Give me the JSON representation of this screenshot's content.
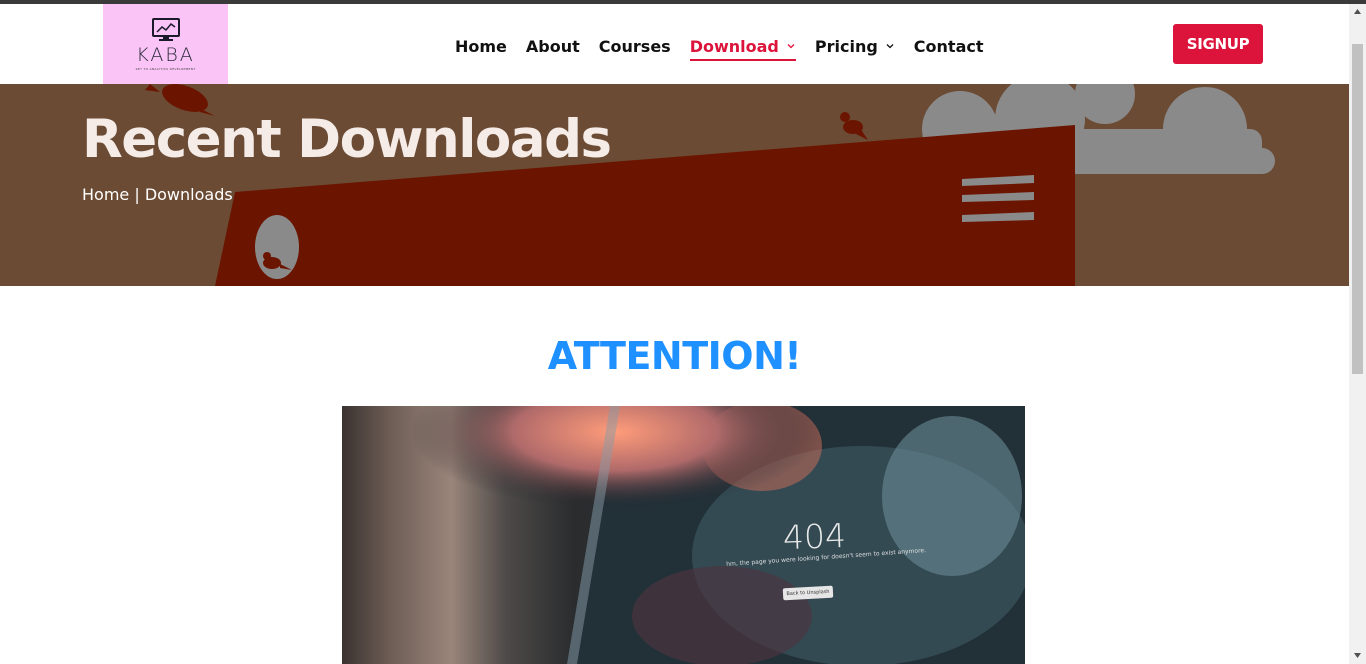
{
  "brand": {
    "name": "KABA",
    "tagline": "KEY TO ANALYTICS DEVELOPMENT",
    "logo_bg": "#fbc4f6"
  },
  "nav": {
    "items": [
      {
        "label": "Home",
        "active": false,
        "dropdown": false
      },
      {
        "label": "About",
        "active": false,
        "dropdown": false
      },
      {
        "label": "Courses",
        "active": false,
        "dropdown": false
      },
      {
        "label": "Download",
        "active": true,
        "dropdown": true
      },
      {
        "label": "Pricing",
        "active": false,
        "dropdown": true
      },
      {
        "label": "Contact",
        "active": false,
        "dropdown": false
      }
    ],
    "signup_label": "SIGNUP"
  },
  "hero": {
    "title": "Recent Downloads",
    "breadcrumb": "Home | Downloads"
  },
  "content": {
    "heading": "ATTENTION!",
    "image": {
      "error_code": "404",
      "message": "hm, the page you were looking for doesn't seem to exist anymore.",
      "button_label": "Back to Unsplash"
    }
  },
  "colors": {
    "accent": "#dc143c",
    "hero_bg": "#6b4b34",
    "hero_panel": "#6b1500",
    "heading": "#1e90ff"
  },
  "icons": [
    "monitor-chart-icon",
    "chevron-down-icon",
    "bird-icon",
    "cloud-shape",
    "menu-lines-icon"
  ]
}
